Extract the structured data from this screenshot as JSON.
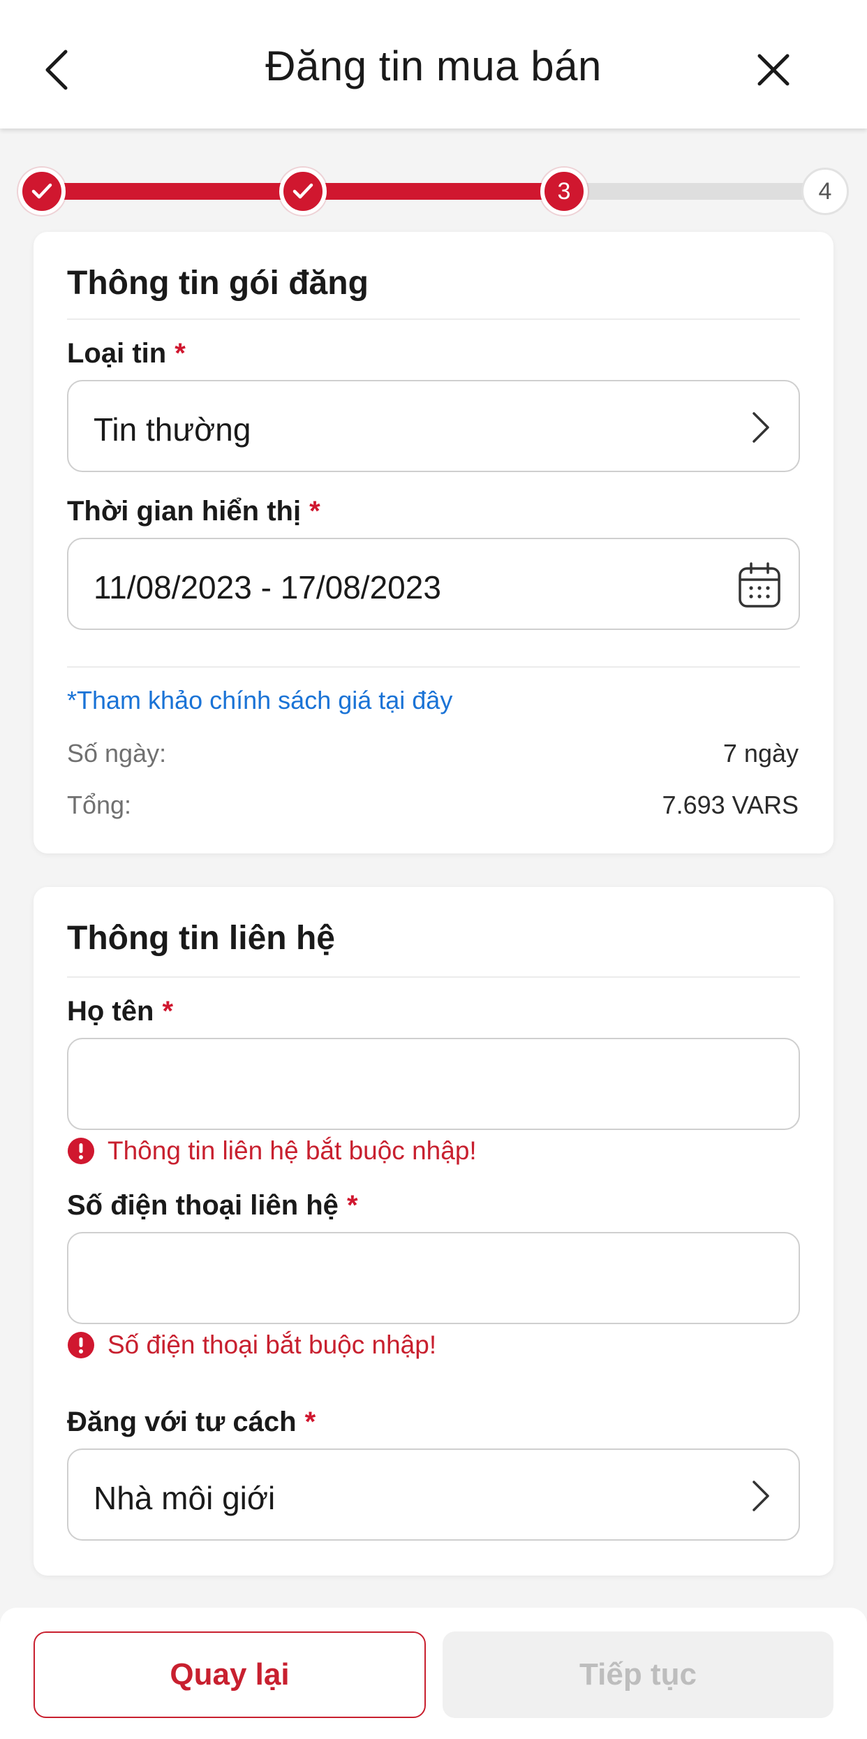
{
  "header": {
    "title": "Đăng tin mua bán",
    "back_icon": "chevron-left-icon",
    "close_icon": "close-icon"
  },
  "stepper": {
    "steps": [
      {
        "state": "done",
        "icon": "check-icon"
      },
      {
        "state": "done",
        "icon": "check-icon"
      },
      {
        "state": "current",
        "label": "3"
      },
      {
        "state": "upcoming",
        "label": "4"
      }
    ],
    "active_color": "#d0172f",
    "inactive_color": "#dedede"
  },
  "package": {
    "title": "Thông tin gói đăng",
    "listing_type": {
      "label": "Loại tin",
      "required_mark": "*",
      "value": "Tin thường"
    },
    "display_time": {
      "label": "Thời gian hiển thị",
      "required_mark": "*",
      "value": "11/08/2023 - 17/08/2023"
    },
    "policy_link": "*Tham khảo chính sách giá tại đây",
    "days": {
      "label": "Số ngày:",
      "value": "7 ngày"
    },
    "total": {
      "label": "Tổng:",
      "value": "7.693 VARS"
    }
  },
  "contact": {
    "title": "Thông tin liên hệ",
    "name": {
      "label": "Họ tên",
      "required_mark": "*",
      "value": "",
      "error": "Thông tin liên hệ bắt buộc nhập!"
    },
    "phone": {
      "label": "Số điện thoại liên hệ",
      "required_mark": "*",
      "value": "",
      "error": "Số điện thoại bắt buộc nhập!"
    },
    "role": {
      "label": "Đăng với tư cách",
      "required_mark": "*",
      "value": "Nhà môi giới"
    }
  },
  "footer": {
    "back_label": "Quay lại",
    "next_label": "Tiếp tục"
  },
  "colors": {
    "brand_red": "#d0172f",
    "error_red": "#c8202f",
    "link_blue": "#1a73d6"
  }
}
